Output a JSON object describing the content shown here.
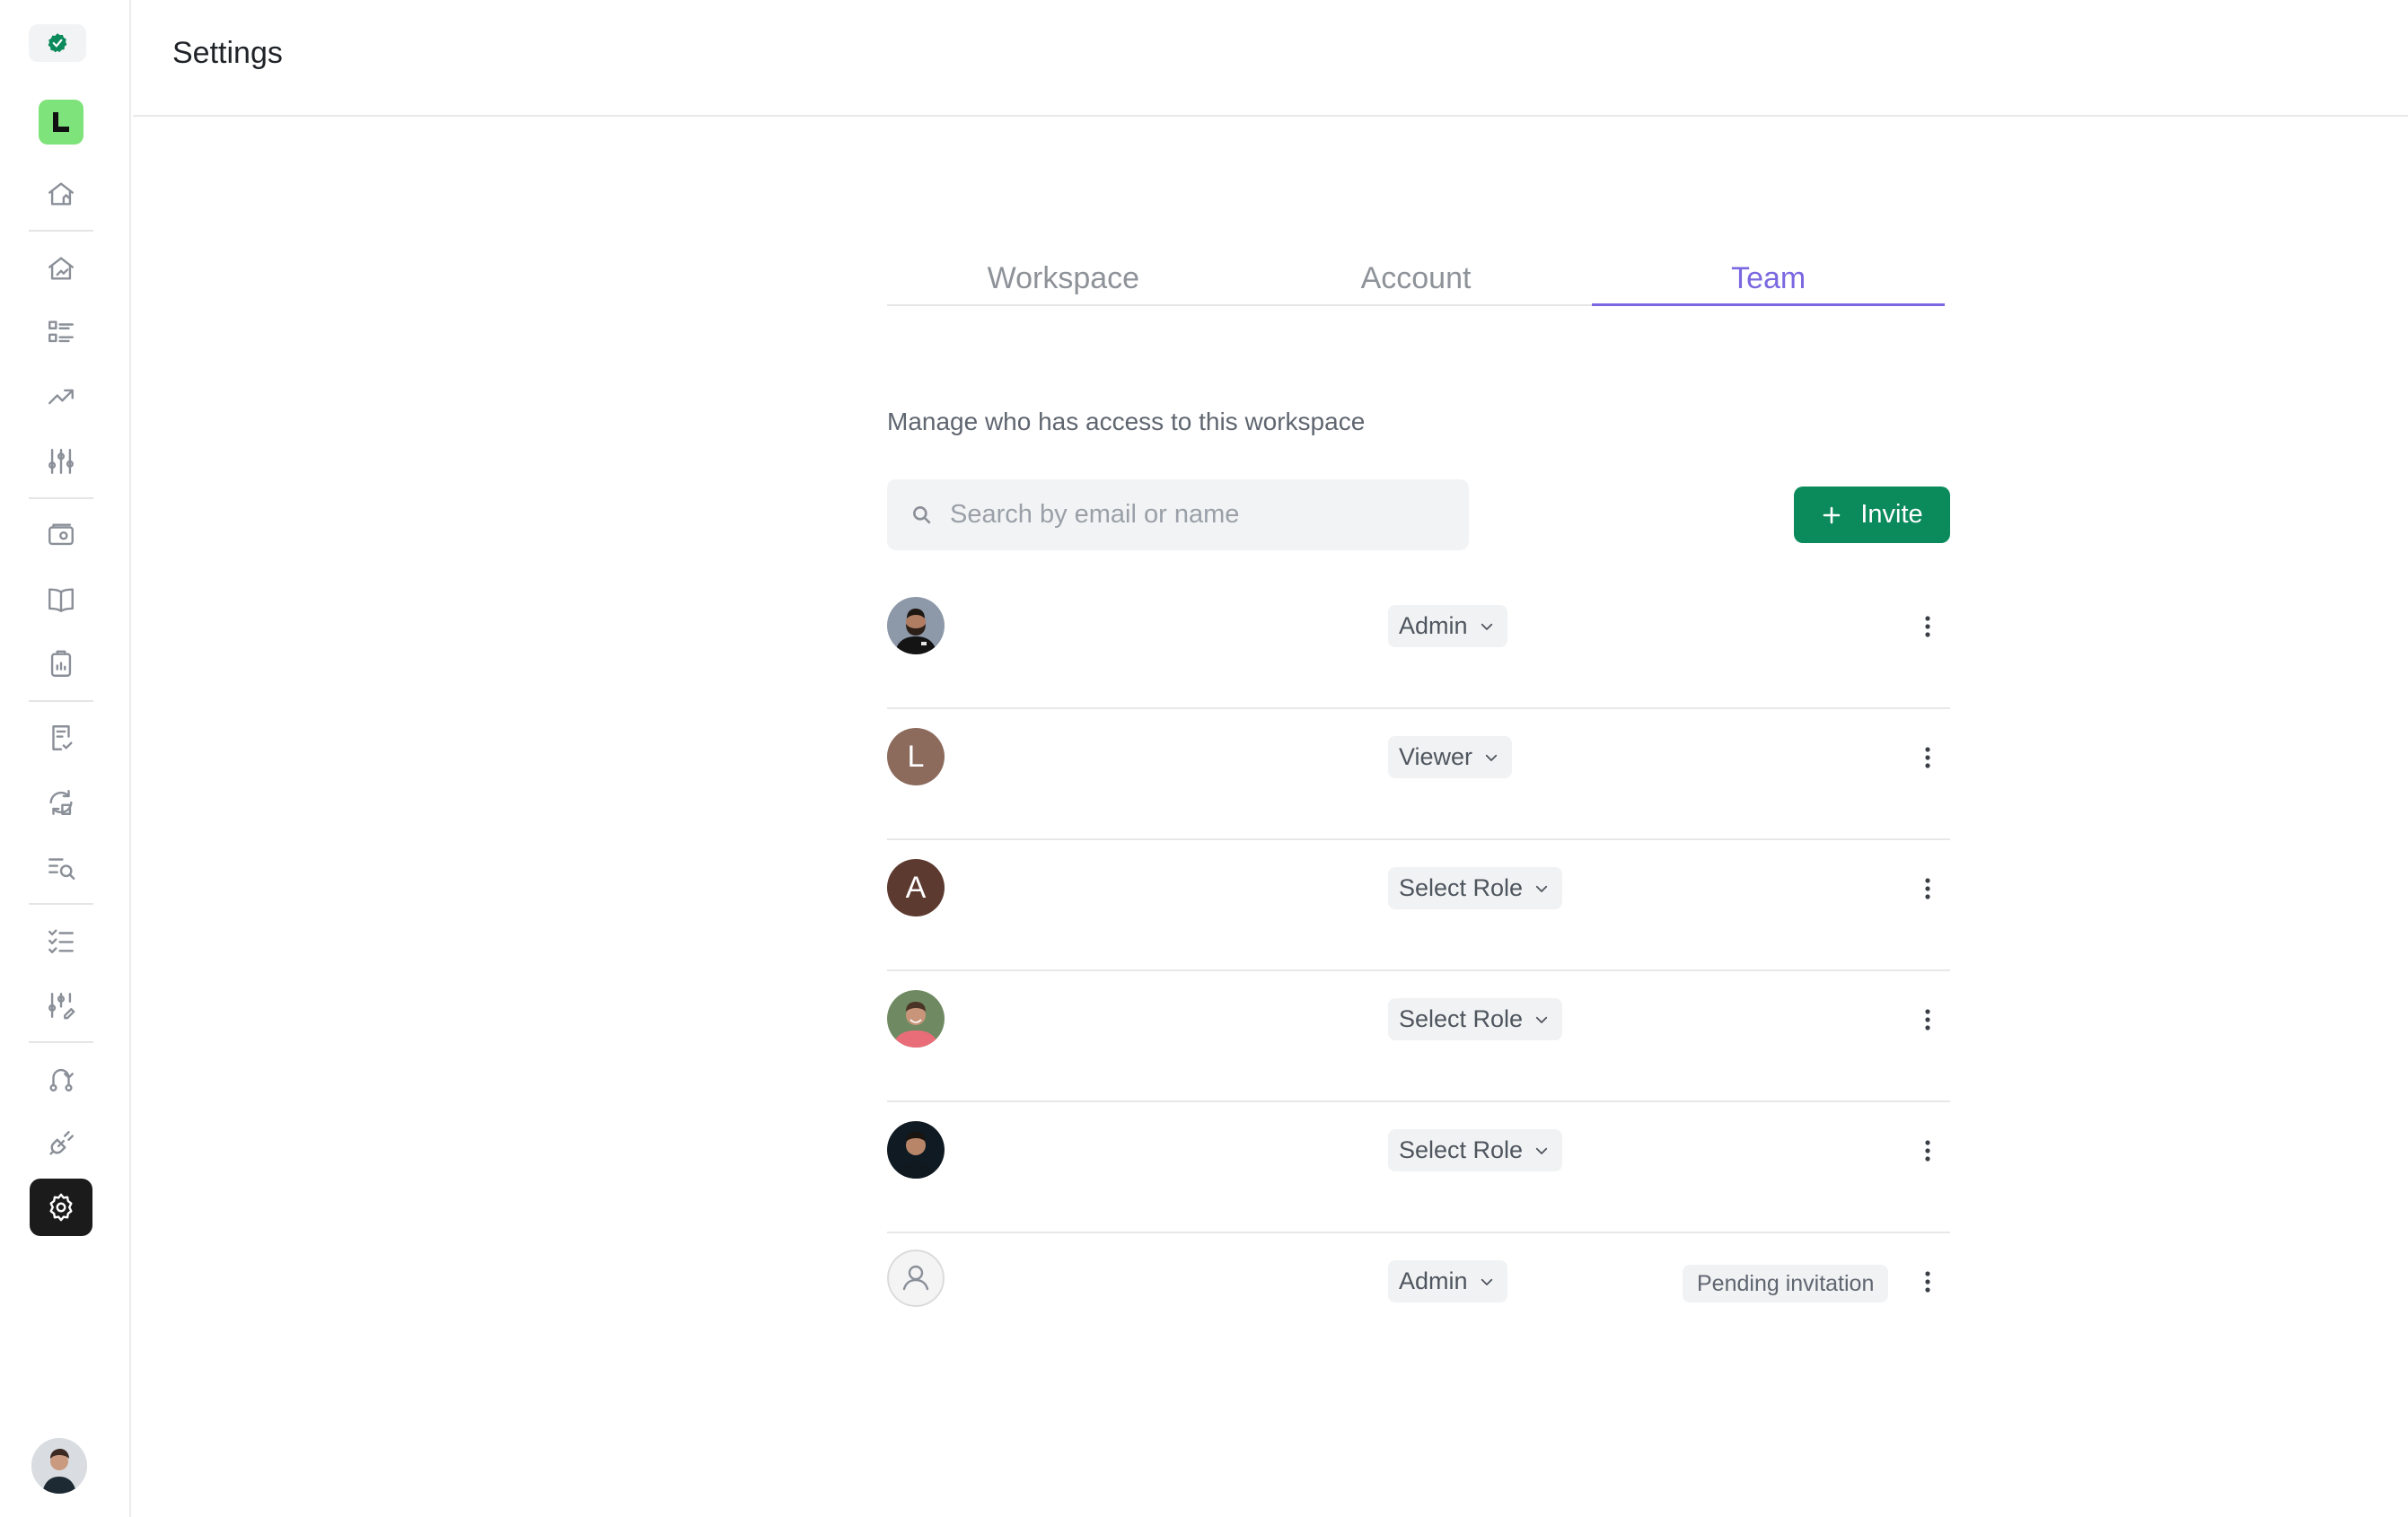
{
  "header": {
    "title": "Settings"
  },
  "tabs": [
    {
      "label": "Workspace",
      "active": false
    },
    {
      "label": "Account",
      "active": false
    },
    {
      "label": "Team",
      "active": true
    }
  ],
  "team": {
    "description": "Manage who has access to this workspace",
    "search_placeholder": "Search by email or name",
    "invite_label": "Invite"
  },
  "members": [
    {
      "avatar": "photo",
      "initial": "",
      "role": "Admin",
      "badge": ""
    },
    {
      "avatar": "initial",
      "initial": "L",
      "role": "Viewer",
      "badge": ""
    },
    {
      "avatar": "initial",
      "initial": "A",
      "role": "Select Role",
      "badge": ""
    },
    {
      "avatar": "photo",
      "initial": "",
      "role": "Select Role",
      "badge": ""
    },
    {
      "avatar": "photo",
      "initial": "",
      "role": "Select Role",
      "badge": ""
    },
    {
      "avatar": "placeholder",
      "initial": "",
      "role": "Admin",
      "badge": "Pending invitation"
    }
  ],
  "colors": {
    "accent": "#7a68e0",
    "primary_button": "#0b8a5b",
    "logo": "#7ee37a",
    "avatar_l": "#8c6b5d",
    "avatar_a": "#5c3a30"
  },
  "sidebar_icons": [
    "verified-badge-icon",
    "app-logo-icon",
    "home-icon",
    "home-chart-icon",
    "list-icon",
    "trend-up-icon",
    "sliders-icon",
    "wallet-icon",
    "book-icon",
    "clipboard-icon",
    "document-check-icon",
    "sync-icon",
    "search-list-icon",
    "checklist-icon",
    "sliders-edit-icon",
    "route-icon",
    "plug-icon",
    "settings-icon"
  ]
}
